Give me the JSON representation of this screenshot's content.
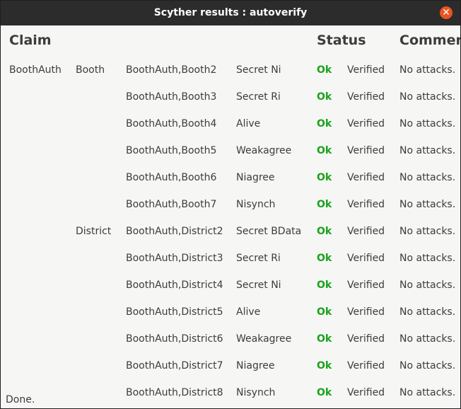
{
  "window": {
    "title": "Scyther results : autoverify",
    "close_glyph": "✕"
  },
  "headers": {
    "claim": "Claim",
    "status": "Status",
    "comments": "Commer"
  },
  "colors": {
    "ok": "#19a219",
    "close_button": "#e95420"
  },
  "rows": [
    {
      "protocol": "BoothAuth",
      "role": "Booth",
      "claim_id": "BoothAuth,Booth2",
      "claim": "Secret Ni",
      "status": "Ok",
      "verified": "Verified",
      "comment": "No attacks."
    },
    {
      "protocol": "",
      "role": "",
      "claim_id": "BoothAuth,Booth3",
      "claim": "Secret Ri",
      "status": "Ok",
      "verified": "Verified",
      "comment": "No attacks."
    },
    {
      "protocol": "",
      "role": "",
      "claim_id": "BoothAuth,Booth4",
      "claim": "Alive",
      "status": "Ok",
      "verified": "Verified",
      "comment": "No attacks."
    },
    {
      "protocol": "",
      "role": "",
      "claim_id": "BoothAuth,Booth5",
      "claim": "Weakagree",
      "status": "Ok",
      "verified": "Verified",
      "comment": "No attacks."
    },
    {
      "protocol": "",
      "role": "",
      "claim_id": "BoothAuth,Booth6",
      "claim": "Niagree",
      "status": "Ok",
      "verified": "Verified",
      "comment": "No attacks."
    },
    {
      "protocol": "",
      "role": "",
      "claim_id": "BoothAuth,Booth7",
      "claim": "Nisynch",
      "status": "Ok",
      "verified": "Verified",
      "comment": "No attacks."
    },
    {
      "protocol": "",
      "role": "District",
      "claim_id": "BoothAuth,District2",
      "claim": "Secret BData",
      "status": "Ok",
      "verified": "Verified",
      "comment": "No attacks."
    },
    {
      "protocol": "",
      "role": "",
      "claim_id": "BoothAuth,District3",
      "claim": "Secret Ri",
      "status": "Ok",
      "verified": "Verified",
      "comment": "No attacks."
    },
    {
      "protocol": "",
      "role": "",
      "claim_id": "BoothAuth,District4",
      "claim": "Secret Ni",
      "status": "Ok",
      "verified": "Verified",
      "comment": "No attacks."
    },
    {
      "protocol": "",
      "role": "",
      "claim_id": "BoothAuth,District5",
      "claim": "Alive",
      "status": "Ok",
      "verified": "Verified",
      "comment": "No attacks."
    },
    {
      "protocol": "",
      "role": "",
      "claim_id": "BoothAuth,District6",
      "claim": "Weakagree",
      "status": "Ok",
      "verified": "Verified",
      "comment": "No attacks."
    },
    {
      "protocol": "",
      "role": "",
      "claim_id": "BoothAuth,District7",
      "claim": "Niagree",
      "status": "Ok",
      "verified": "Verified",
      "comment": "No attacks."
    },
    {
      "protocol": "",
      "role": "",
      "claim_id": "BoothAuth,District8",
      "claim": "Nisynch",
      "status": "Ok",
      "verified": "Verified",
      "comment": "No attacks."
    }
  ],
  "statusbar": {
    "text": "Done."
  }
}
